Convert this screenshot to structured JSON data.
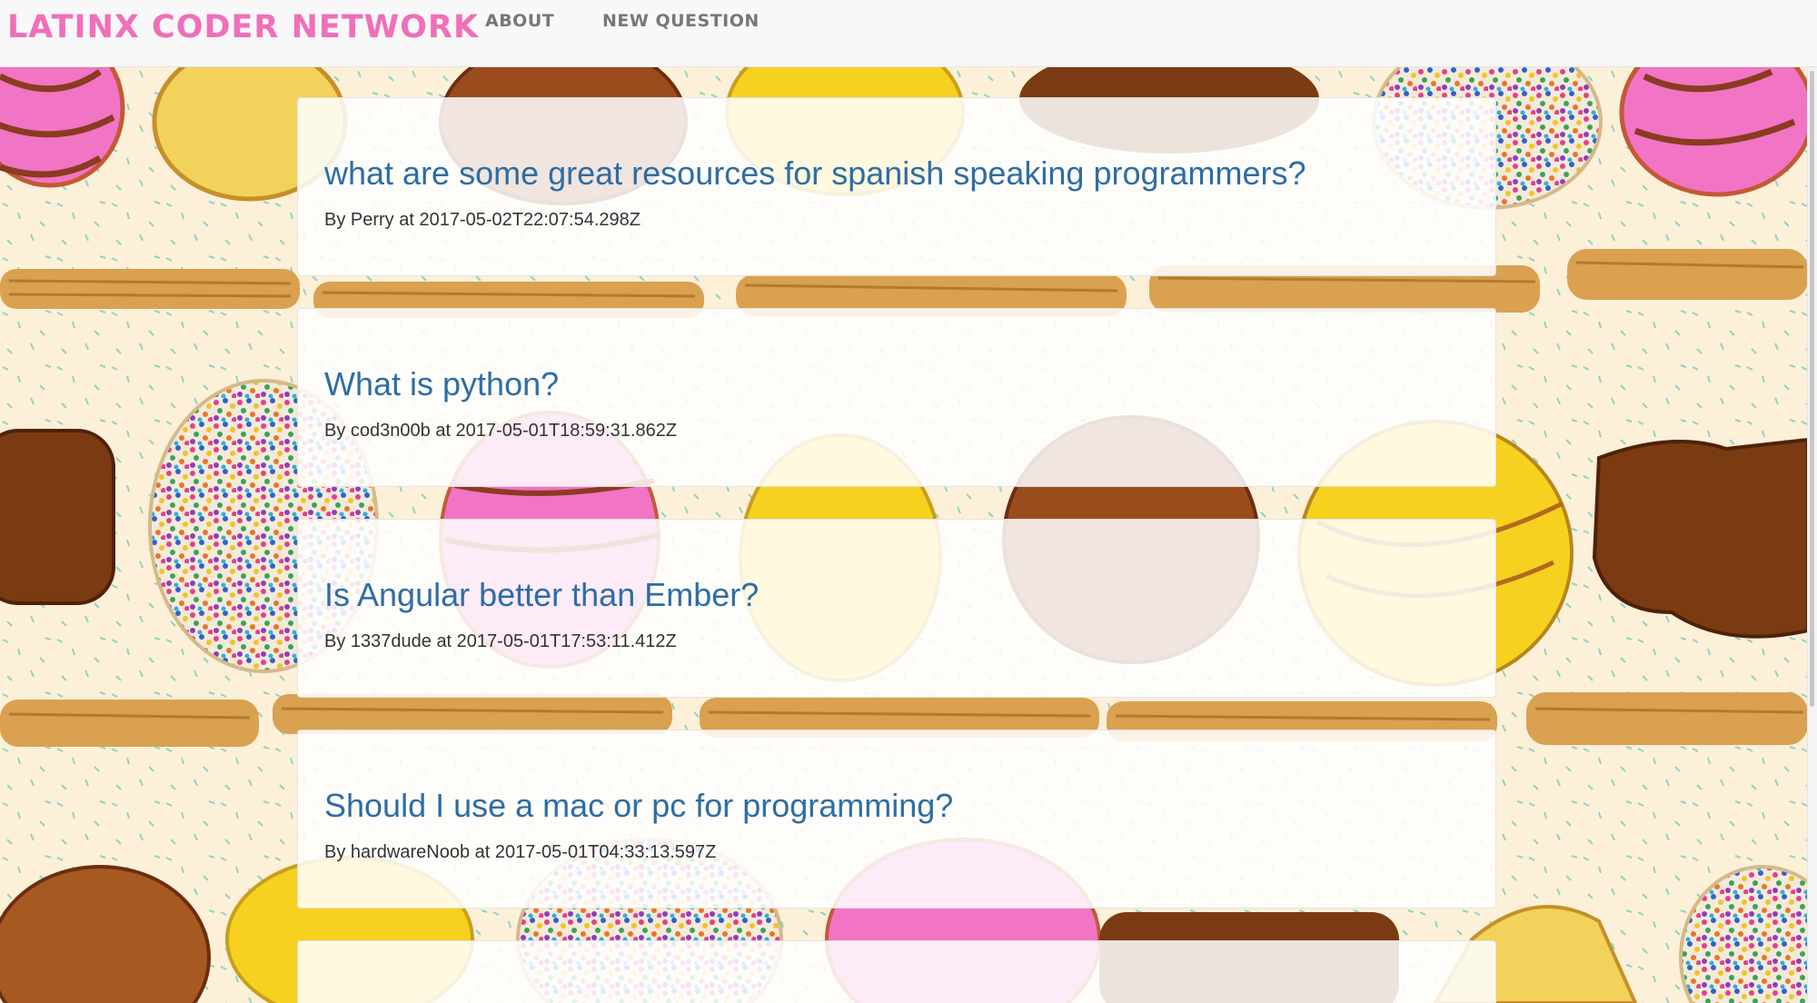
{
  "nav": {
    "brand": "LATINX CODER NETWORK",
    "links": [
      {
        "label": "ABOUT"
      },
      {
        "label": "NEW QUESTION"
      }
    ]
  },
  "questions": [
    {
      "title": "what are some great resources for spanish speaking programmers?",
      "meta": "By Perry at 2017-05-02T22:07:54.298Z"
    },
    {
      "title": "What is python?",
      "meta": "By cod3n00b at 2017-05-01T18:59:31.862Z"
    },
    {
      "title": "Is Angular better than Ember?",
      "meta": "By 1337dude at 2017-05-01T17:53:11.412Z"
    },
    {
      "title": "Should I use a mac or pc for programming?",
      "meta": "By hardwareNoob at 2017-05-01T04:33:13.597Z"
    },
    {
      "title": "",
      "meta": ""
    }
  ],
  "colors": {
    "brand": "#f06fb9",
    "link": "#2e6da4",
    "nav_text": "#777777",
    "background": "#fdf0d8"
  }
}
